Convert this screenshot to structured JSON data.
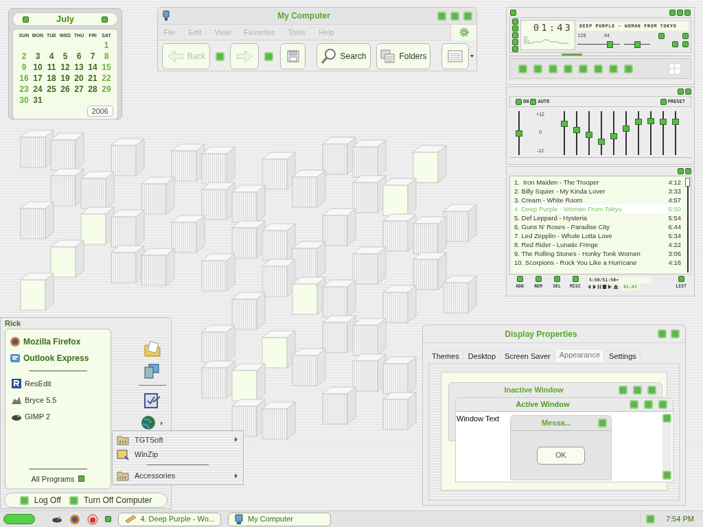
{
  "calendar": {
    "month": "July",
    "weekdays": [
      "SUN",
      "MON",
      "TUE",
      "WED",
      "THU",
      "FRI",
      "SAT"
    ],
    "weeks": [
      [
        "1"
      ],
      [
        "2",
        "3",
        "4",
        "5",
        "6",
        "7",
        "8"
      ],
      [
        "9",
        "10",
        "11",
        "12",
        "13",
        "14",
        "15"
      ],
      [
        "16",
        "17",
        "18",
        "19",
        "20",
        "21",
        "22"
      ],
      [
        "23",
        "24",
        "25",
        "26",
        "27",
        "28",
        "29"
      ],
      [
        "30",
        "31"
      ]
    ],
    "year": "2006"
  },
  "my_computer": {
    "title": "My Computer",
    "menu": [
      "File",
      "Edit",
      "View",
      "Favorites",
      "Tools",
      "Help"
    ],
    "toolbar": [
      {
        "kind": "back",
        "label": "Back",
        "disabled": true
      },
      {
        "kind": "forward",
        "disabled": true
      },
      {
        "kind": "save",
        "disabled": false
      },
      {
        "kind": "search",
        "label": "Search",
        "disabled": false
      },
      {
        "kind": "folders",
        "label": "Folders",
        "disabled": false
      },
      {
        "kind": "views",
        "disabled": false
      }
    ]
  },
  "player": {
    "time": "01:43",
    "song": "DEEP PURPLE - WOMAN FROM TOKYO",
    "kbps": "128",
    "khz": "44",
    "seek": {
      "level": 0.33
    },
    "volume": {
      "level": 0.82
    },
    "balance": {
      "level": 0.5
    }
  },
  "equalizer": {
    "on_label": "ON",
    "auto_label": "AUTO",
    "preset_label": "PRESET",
    "scale": [
      "+12",
      "0",
      "-12"
    ],
    "preamp": {
      "level": 0.5
    },
    "bands": [
      {
        "level": 0.75
      },
      {
        "level": 0.58
      },
      {
        "level": 0.45
      },
      {
        "level": 0.27
      },
      {
        "level": 0.42
      },
      {
        "level": 0.62
      },
      {
        "level": 0.8
      },
      {
        "level": 0.82
      },
      {
        "level": 0.8
      },
      {
        "level": 0.8
      }
    ]
  },
  "playlist": {
    "tracks": [
      {
        "title": "1.  Iron Maiden - The Trooper",
        "duration": "4:12",
        "selected": false
      },
      {
        "title": "2. Billy Squier - My Kinda Lover",
        "duration": "3:33",
        "selected": false
      },
      {
        "title": "3. Cream - White Room",
        "duration": "4:57",
        "selected": false
      },
      {
        "title": "4. Deep Purple - Woman From Tokyo",
        "duration": "5:50",
        "selected": true
      },
      {
        "title": "5. Def Leppard - Hysteria",
        "duration": "5:54",
        "selected": false
      },
      {
        "title": "6. Guns N' Roses - Paradise City",
        "duration": "6:44",
        "selected": false
      },
      {
        "title": "7. Led Zepplin - Whole Lotta Love",
        "duration": "5:34",
        "selected": false
      },
      {
        "title": "8. Red Rider - Lunatic Fringe",
        "duration": "4:22",
        "selected": false
      },
      {
        "title": "9. The Rolling Stones - Honky Tonk Women",
        "duration": "3:06",
        "selected": false
      },
      {
        "title": "10. Scorpions - Rock You Like a Hurricane",
        "duration": "4:16",
        "selected": false
      }
    ],
    "buttons": [
      "ADD",
      "REM",
      "SEL",
      "MISC"
    ],
    "list_button": "LIST",
    "total_time": "5:50/51:50+",
    "time": "01:43"
  },
  "start_menu": {
    "user": "Rick",
    "pinned": [
      "Mozilla Firefox",
      "Outlook Express"
    ],
    "recent": [
      "ResEdit",
      "Bryce 5.5",
      "GIMP 2"
    ],
    "all_programs": "All Programs",
    "submenu": [
      {
        "label": "TGTSoft",
        "has_submenu": true
      },
      {
        "label": "WinZip",
        "has_submenu": false
      },
      {
        "label": "Accessories",
        "has_submenu": true
      }
    ],
    "footer": [
      "Log Off",
      "Turn Off Computer"
    ]
  },
  "display_properties": {
    "title": "Display Properties",
    "tabs": [
      {
        "label": "Themes",
        "selected": false
      },
      {
        "label": "Desktop",
        "selected": false
      },
      {
        "label": "Screen Saver",
        "selected": false
      },
      {
        "label": "Appearance",
        "selected": true
      },
      {
        "label": "Settings",
        "selected": false
      }
    ],
    "preview": {
      "inactive_title": "Inactive Window",
      "active_title": "Active Window",
      "window_text": "Window Text",
      "message_title": "Messa...",
      "ok": "OK"
    }
  },
  "taskbar": {
    "tasks": [
      "4. Deep Purple - Wo...",
      "My Computer"
    ],
    "clock": "7:54 PM"
  }
}
